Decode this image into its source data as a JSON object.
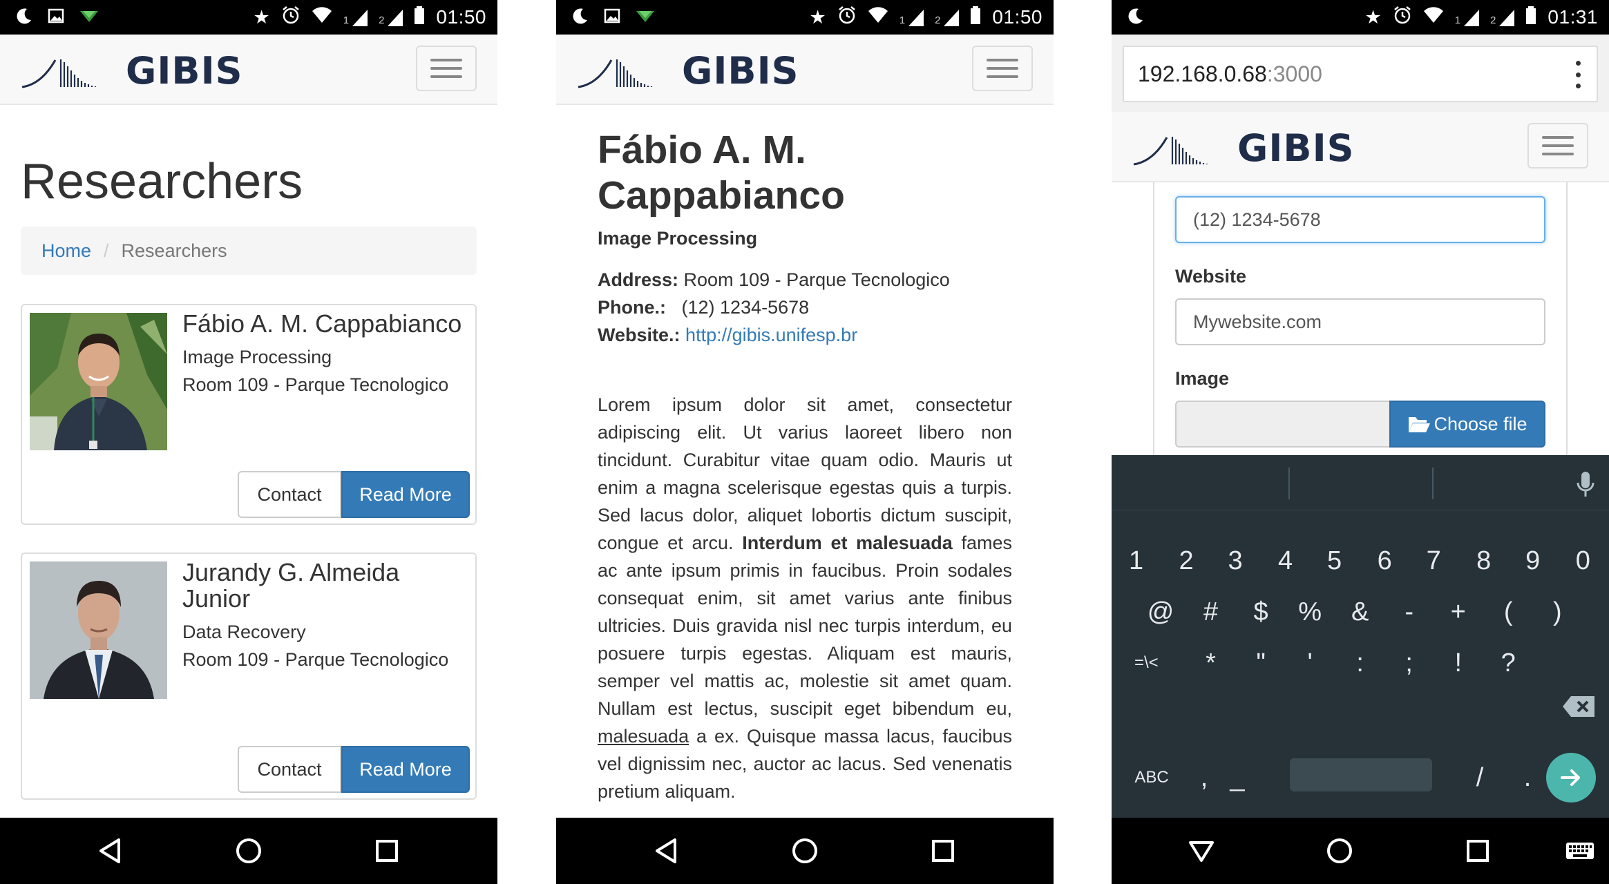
{
  "phone1": {
    "status": {
      "time": "01:50",
      "sim1": "1",
      "sim2": "2"
    },
    "logo_text": "GIBIS",
    "page_title": "Researchers",
    "breadcrumb": {
      "home": "Home",
      "separator": "/",
      "current": "Researchers"
    },
    "researchers": [
      {
        "name": "Fábio A. M. Cappabianco",
        "dept": "Image Processing",
        "room": "Room 109 - Parque Tecnologico",
        "contact_label": "Contact",
        "read_more_label": "Read More"
      },
      {
        "name": "Jurandy G. Almeida Junior",
        "dept": "Data Recovery",
        "room": "Room 109 - Parque Tecnologico",
        "contact_label": "Contact",
        "read_more_label": "Read More"
      }
    ]
  },
  "phone2": {
    "status": {
      "time": "01:50",
      "sim1": "1",
      "sim2": "2"
    },
    "logo_text": "GIBIS",
    "name": "Fábio A. M. Cappabianco",
    "dept": "Image Processing",
    "address_label": "Address:",
    "address_value": "Room 109 - Parque Tecnologico",
    "phone_label": "Phone.:",
    "phone_value": "(12) 1234-5678",
    "website_label": "Website.:",
    "website_value": "http://gibis.unifesp.br",
    "bio_part1": "Lorem ipsum dolor sit amet, consectetur adipiscing elit. Ut varius laoreet libero non tincidunt. Curabitur vitae quam odio. Mauris ut enim a magna scelerisque egestas quis a turpis. Sed lacus dolor, aliquet lobortis dictum suscipit, congue et arcu. ",
    "bio_bold": "Interdum et malesuada",
    "bio_part2": " fames ac ante ipsum primis in faucibus. Proin sodales consequat enim, sit amet varius ante finibus ultricies. Duis gravida nisl nec turpis interdum, eu posuere turpis egestas. Aliquam est mauris, semper vel mattis ac, molestie sit amet quam. Nullam est lectus, suscipit eget bibendum eu, ",
    "bio_underline": "malesuada",
    "bio_part3": " a ex. Quisque massa lacus, faucibus vel dignissim nec, auctor ac lacus. Sed venenatis pretium aliquam."
  },
  "phone3": {
    "status": {
      "time": "01:31",
      "sim1": "1",
      "sim2": "2"
    },
    "url_host": "192.168.0.68",
    "url_port": ":3000",
    "logo_text": "GIBIS",
    "phone_field_value": "(12) 1234-5678",
    "website_label": "Website",
    "website_placeholder": "Mywebsite.com",
    "image_label": "Image",
    "choose_file_label": "Choose file",
    "keyboard": {
      "row1": [
        "1",
        "2",
        "3",
        "4",
        "5",
        "6",
        "7",
        "8",
        "9",
        "0"
      ],
      "row2": [
        "@",
        "#",
        "$",
        "%",
        "&",
        "-",
        "+",
        "(",
        ")"
      ],
      "row3": [
        "=\\<",
        "*",
        "\"",
        "'",
        ":",
        ";",
        "!",
        "?"
      ],
      "abc_label": "ABC",
      "comma": ",",
      "underscore": "_",
      "slash": "/",
      "period": "."
    }
  },
  "colors": {
    "primary": "#337ab7",
    "navbar_bg": "#f8f8f8",
    "logo": "#1f2d4a",
    "keyboard_bg": "#263238",
    "enter_key": "#4db6ac"
  }
}
